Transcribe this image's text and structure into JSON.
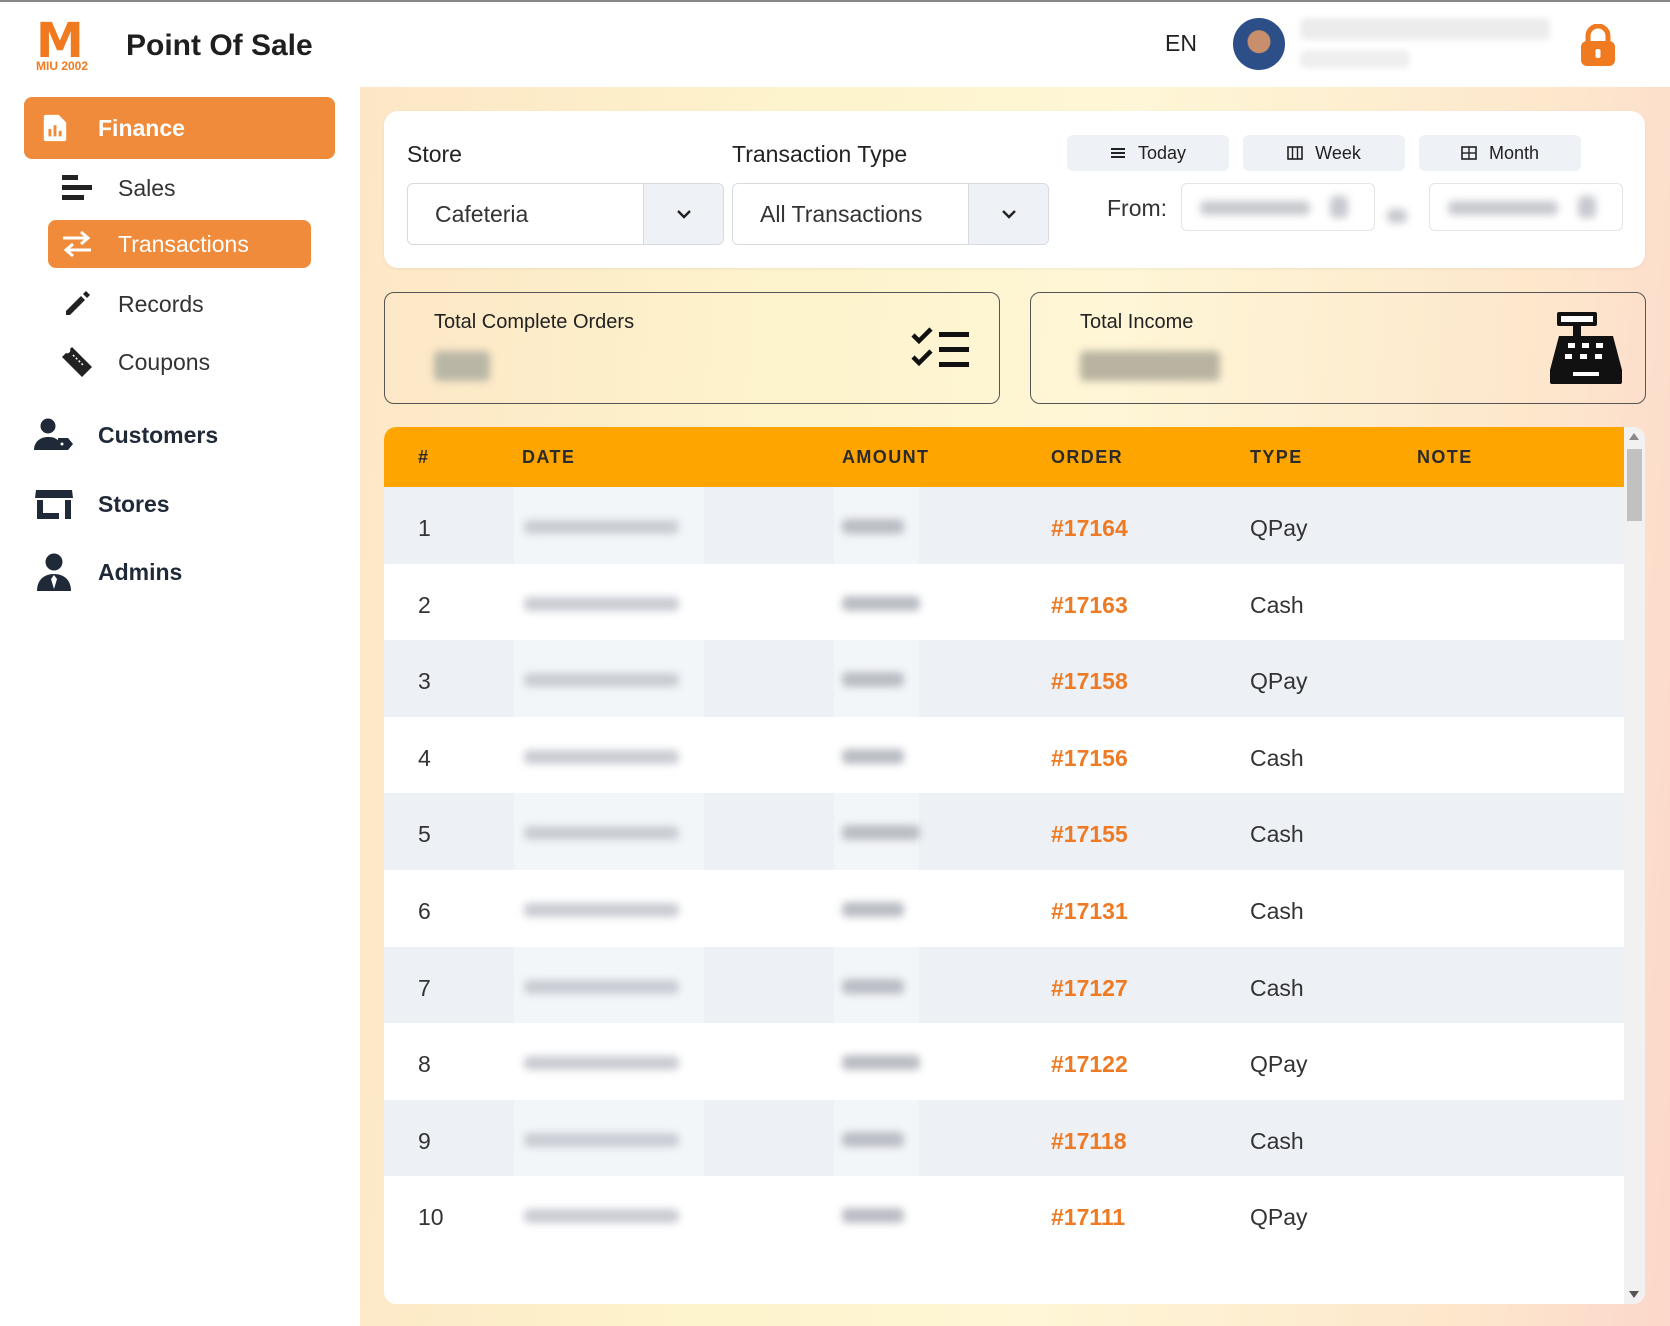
{
  "brand": {
    "logo_text": "M",
    "logo_year": "MIU 2002",
    "title": "Point Of Sale"
  },
  "sidebar": {
    "finance": {
      "label": "Finance",
      "icon": "chart-file-icon"
    },
    "finance_items": [
      {
        "label": "Sales",
        "icon": "bars-icon"
      },
      {
        "label": "Transactions",
        "icon": "swap-arrows-icon",
        "active": true
      },
      {
        "label": "Records",
        "icon": "pencil-icon"
      },
      {
        "label": "Coupons",
        "icon": "ticket-icon"
      }
    ],
    "main_items": [
      {
        "label": "Customers",
        "icon": "user-tag-icon"
      },
      {
        "label": "Stores",
        "icon": "store-icon"
      },
      {
        "label": "Admins",
        "icon": "user-tie-icon"
      }
    ]
  },
  "header": {
    "language": "EN",
    "lock_icon": "lock-icon"
  },
  "filters": {
    "store_label": "Store",
    "store_value": "Cafeteria",
    "type_label": "Transaction Type",
    "type_value": "All Transactions",
    "range_buttons": [
      {
        "label": "Today",
        "icon": "list-icon"
      },
      {
        "label": "Week",
        "icon": "week-grid-icon"
      },
      {
        "label": "Month",
        "icon": "month-grid-icon"
      }
    ],
    "from_label": "From:"
  },
  "stats": {
    "orders_title": "Total Complete Orders",
    "orders_icon": "checklist-icon",
    "income_title": "Total Income",
    "income_icon": "cash-register-icon"
  },
  "table": {
    "headers": [
      "#",
      "DATE",
      "AMOUNT",
      "ORDER",
      "TYPE",
      "NOTE"
    ],
    "rows": [
      {
        "num": "1",
        "order": "#17164",
        "type": "QPay",
        "note": ""
      },
      {
        "num": "2",
        "order": "#17163",
        "type": "Cash",
        "note": ""
      },
      {
        "num": "3",
        "order": "#17158",
        "type": "QPay",
        "note": ""
      },
      {
        "num": "4",
        "order": "#17156",
        "type": "Cash",
        "note": ""
      },
      {
        "num": "5",
        "order": "#17155",
        "type": "Cash",
        "note": ""
      },
      {
        "num": "6",
        "order": "#17131",
        "type": "Cash",
        "note": ""
      },
      {
        "num": "7",
        "order": "#17127",
        "type": "Cash",
        "note": ""
      },
      {
        "num": "8",
        "order": "#17122",
        "type": "QPay",
        "note": ""
      },
      {
        "num": "9",
        "order": "#17118",
        "type": "Cash",
        "note": ""
      },
      {
        "num": "10",
        "order": "#17111",
        "type": "QPay",
        "note": ""
      }
    ]
  },
  "colors": {
    "accent": "#EF8B3A",
    "table_header": "#FFA500",
    "order_link": "#EE7A24"
  }
}
